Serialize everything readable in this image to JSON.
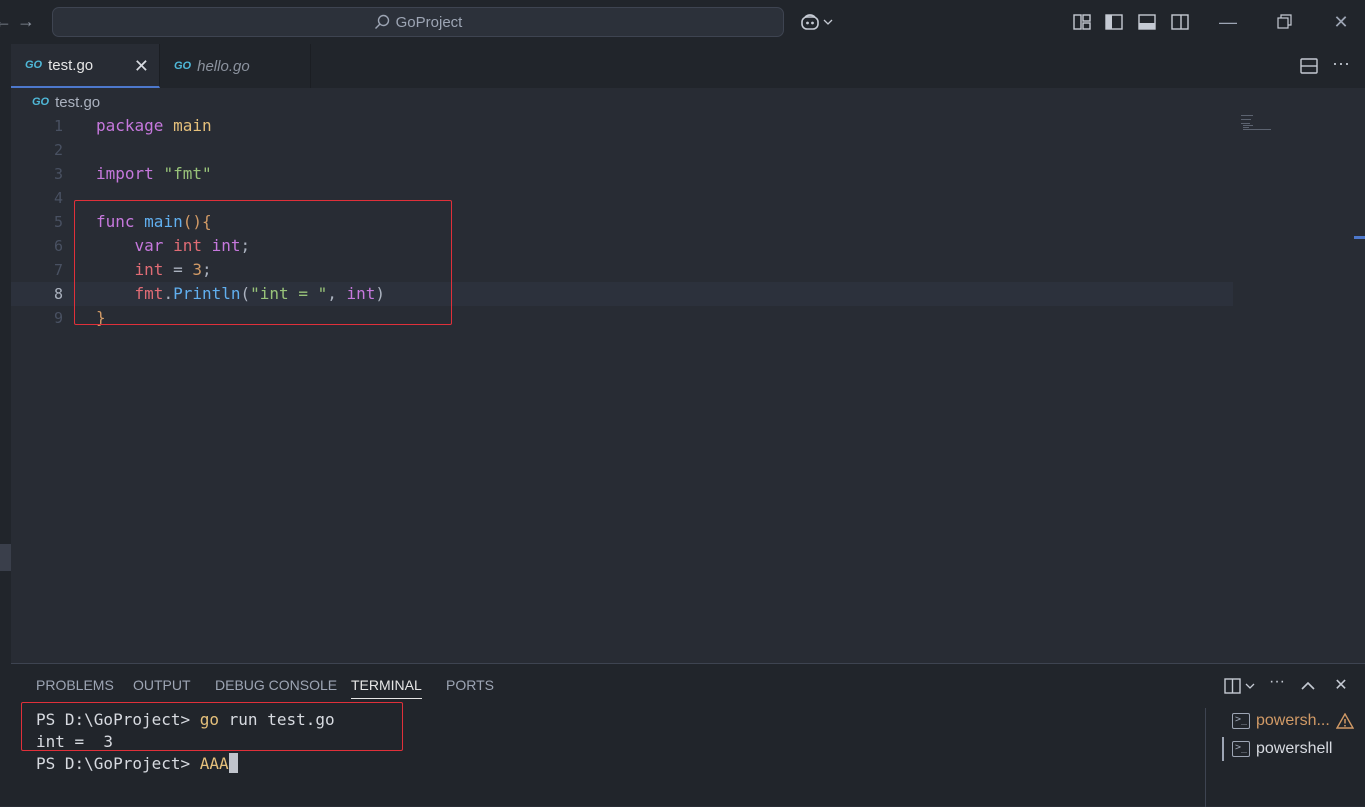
{
  "titlebar": {
    "back_icon": "arrow-left-icon",
    "forward_icon": "arrow-right-icon",
    "search_text": "GoProject"
  },
  "tabs": [
    {
      "badge": "GO",
      "label": "test.go",
      "active": true
    },
    {
      "badge": "GO",
      "label": "hello.go",
      "active": false
    }
  ],
  "breadcrumb": {
    "badge": "GO",
    "label": "test.go"
  },
  "editor": {
    "line_numbers": [
      "1",
      "2",
      "3",
      "4",
      "5",
      "6",
      "7",
      "8",
      "9"
    ],
    "current_line": 8,
    "lines": [
      "package main",
      "",
      "import \"fmt\"",
      "",
      "func main(){",
      "    var int int;",
      "    int = 3;",
      "    fmt.Println(\"int = \", int)",
      "}"
    ]
  },
  "panel": {
    "tabs": [
      "PROBLEMS",
      "OUTPUT",
      "DEBUG CONSOLE",
      "TERMINAL",
      "PORTS"
    ],
    "active_tab": "TERMINAL",
    "terminal": {
      "prompt": "PS D:\\GoProject> ",
      "cmd": "go",
      "args": " run test.go",
      "output": "int =  3",
      "prompt2": "PS D:\\GoProject> ",
      "typed": "AAA"
    },
    "terminals": [
      {
        "label": "powersh...",
        "warning": true
      },
      {
        "label": "powershell",
        "warning": false
      }
    ]
  },
  "colors": {
    "accent": "#4d78cc",
    "highlight_box": "#e0303a",
    "warning": "#d19a66"
  }
}
